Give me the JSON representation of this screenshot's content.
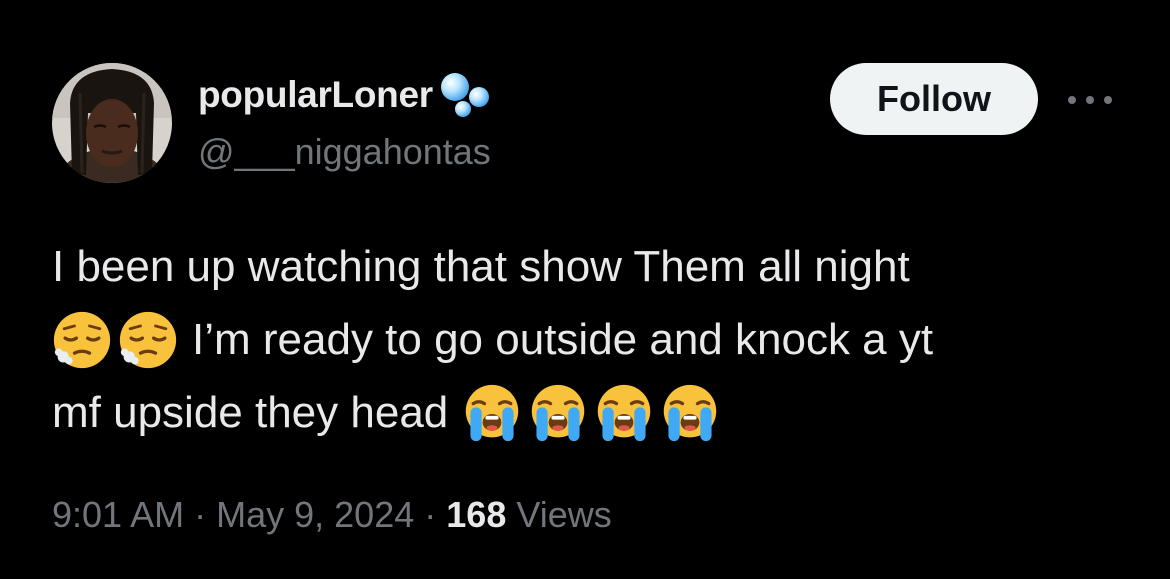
{
  "author": {
    "display_name": "popularLoner",
    "handle": "@___niggahontas",
    "badge_icon": "bubbles-icon",
    "avatar_icon": "avatar-photo"
  },
  "actions": {
    "follow_label": "Follow",
    "more_icon": "more-horizontal-icon"
  },
  "tweet": {
    "line1": "I been up watching that show Them all night",
    "line2_emojis": [
      "relieved-face-emoji",
      "relieved-face-emoji"
    ],
    "line2_text": "I’m ready to go outside and knock a yt",
    "line3_text": "mf upside they head",
    "line3_emojis": [
      "loudly-crying-face-emoji",
      "loudly-crying-face-emoji",
      "loudly-crying-face-emoji",
      "loudly-crying-face-emoji"
    ]
  },
  "meta": {
    "time": "9:01 AM",
    "separator": "·",
    "date": "May 9, 2024",
    "views_count": "168",
    "views_label": "Views"
  },
  "colors": {
    "background": "#000000",
    "primary_text": "#e7e9ea",
    "secondary_text": "#71767b",
    "follow_button_bg": "#eff3f4",
    "follow_button_text": "#0f1419"
  }
}
